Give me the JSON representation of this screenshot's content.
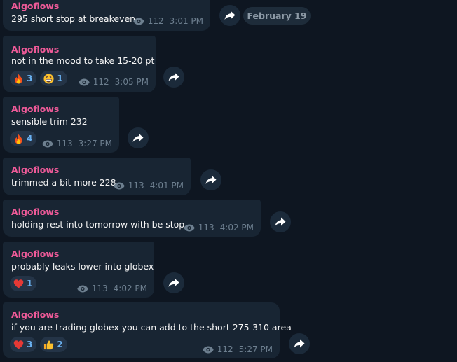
{
  "date_separator": "February 19",
  "messages": [
    {
      "sender": "Algoflows",
      "text": "295 short stop at breakeven",
      "views": "112",
      "time": "3:01 PM",
      "reactions": []
    },
    {
      "sender": "Algoflows",
      "text": "not in the mood to take 15-20 pt",
      "views": "112",
      "time": "3:05 PM",
      "reactions": [
        {
          "emoji": "fire-icon",
          "count": "3"
        },
        {
          "emoji": "beaming-face-icon",
          "count": "1"
        }
      ]
    },
    {
      "sender": "Algoflows",
      "text": "sensible trim 232",
      "views": "113",
      "time": "3:27 PM",
      "reactions": [
        {
          "emoji": "fire-icon",
          "count": "4"
        }
      ]
    },
    {
      "sender": "Algoflows",
      "text": "trimmed a bit more 228",
      "views": "113",
      "time": "4:01 PM",
      "reactions": []
    },
    {
      "sender": "Algoflows",
      "text": "holding rest into tomorrow with be stop",
      "views": "113",
      "time": "4:02 PM",
      "reactions": []
    },
    {
      "sender": "Algoflows",
      "text": "probably leaks lower into globex",
      "views": "113",
      "time": "4:02 PM",
      "reactions": [
        {
          "emoji": "red-heart-icon",
          "count": "1"
        }
      ]
    },
    {
      "sender": "Algoflows",
      "text": "if you are trading globex you can add to the short 275-310 area",
      "views": "112",
      "time": "5:27 PM",
      "reactions": [
        {
          "emoji": "red-heart-icon",
          "count": "3"
        },
        {
          "emoji": "thumbs-up-icon",
          "count": "2"
        }
      ]
    }
  ],
  "colors": {
    "background": "#0e1621",
    "bubble": "#182533",
    "sender": "#ee5a98",
    "meta": "#6d7f8f",
    "reaction_count": "#6ab2f2"
  }
}
